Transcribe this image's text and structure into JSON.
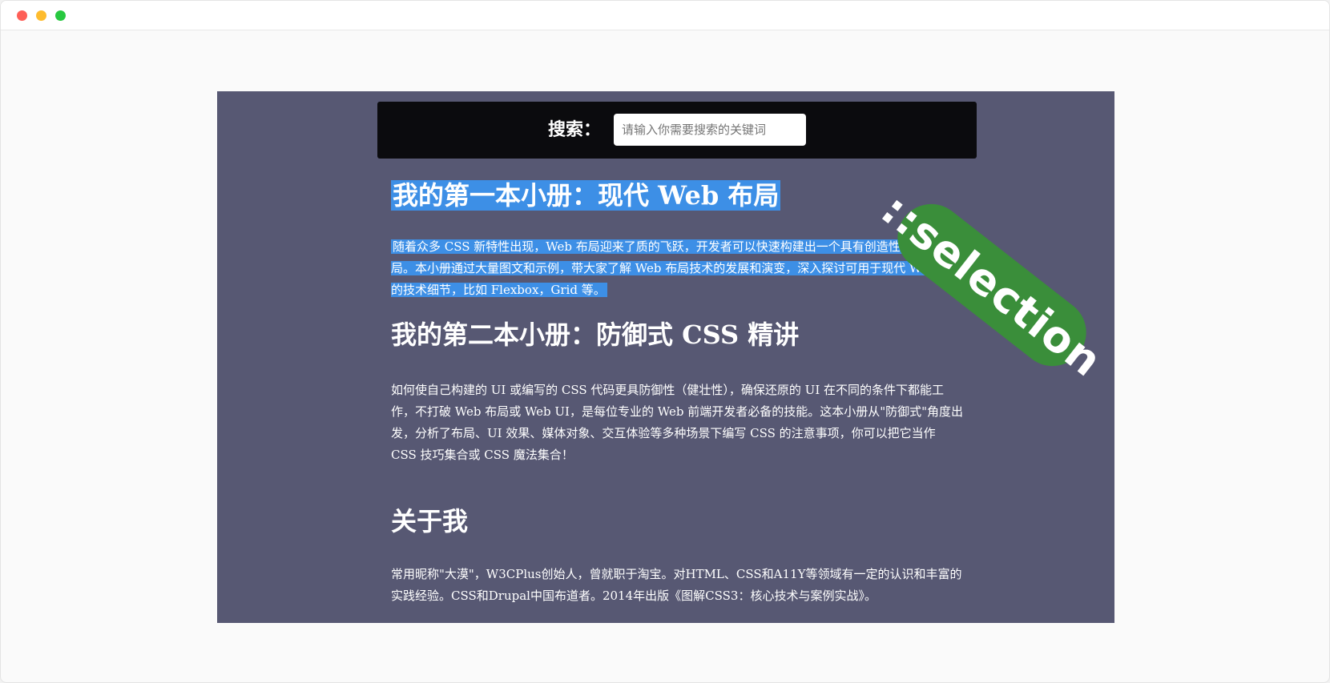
{
  "search": {
    "label": "搜索：",
    "placeholder": "请输入你需要搜索的关键词"
  },
  "articles": [
    {
      "title": "我的第一本小册：现代 Web 布局",
      "body": "随着众多 CSS 新特性出现，Web 布局迎来了质的飞跃，开发者可以快速构建出一个具有创造性的 Web 布局。本小册通过大量图文和示例，带大家了解 Web 布局技术的发展和演变，深入探讨可用于现代 Web 布局的技术细节，比如 Flexbox，Grid 等。",
      "selected": true
    },
    {
      "title": "我的第二本小册：防御式 CSS 精讲",
      "body": "如何使自己构建的 UI 或编写的 CSS 代码更具防御性（健壮性），确保还原的 UI 在不同的条件下都能工作，不打破 Web 布局或 Web UI，是每位专业的 Web 前端开发者必备的技能。这本小册从\"防御式\"角度出发，分析了布局、UI 效果、媒体对象、交互体验等多种场景下编写 CSS 的注意事项，你可以把它当作 CSS 技巧集合或 CSS 魔法集合！",
      "selected": false
    },
    {
      "title": "关于我",
      "body": "常用昵称\"大漠\"，W3CPlus创始人，曾就职于淘宝。对HTML、CSS和A11Y等领域有一定的认识和丰富的实践经验。CSS和Drupal中国布道者。2014年出版《图解CSS3：核心技术与案例实战》。",
      "selected": false
    }
  ],
  "badge": {
    "text": "::selection",
    "color": "#3a8e3a"
  },
  "colors": {
    "stage_background": "#575873",
    "selection_highlight": "#3d8fe6",
    "search_bar": "#0b0b0e"
  }
}
